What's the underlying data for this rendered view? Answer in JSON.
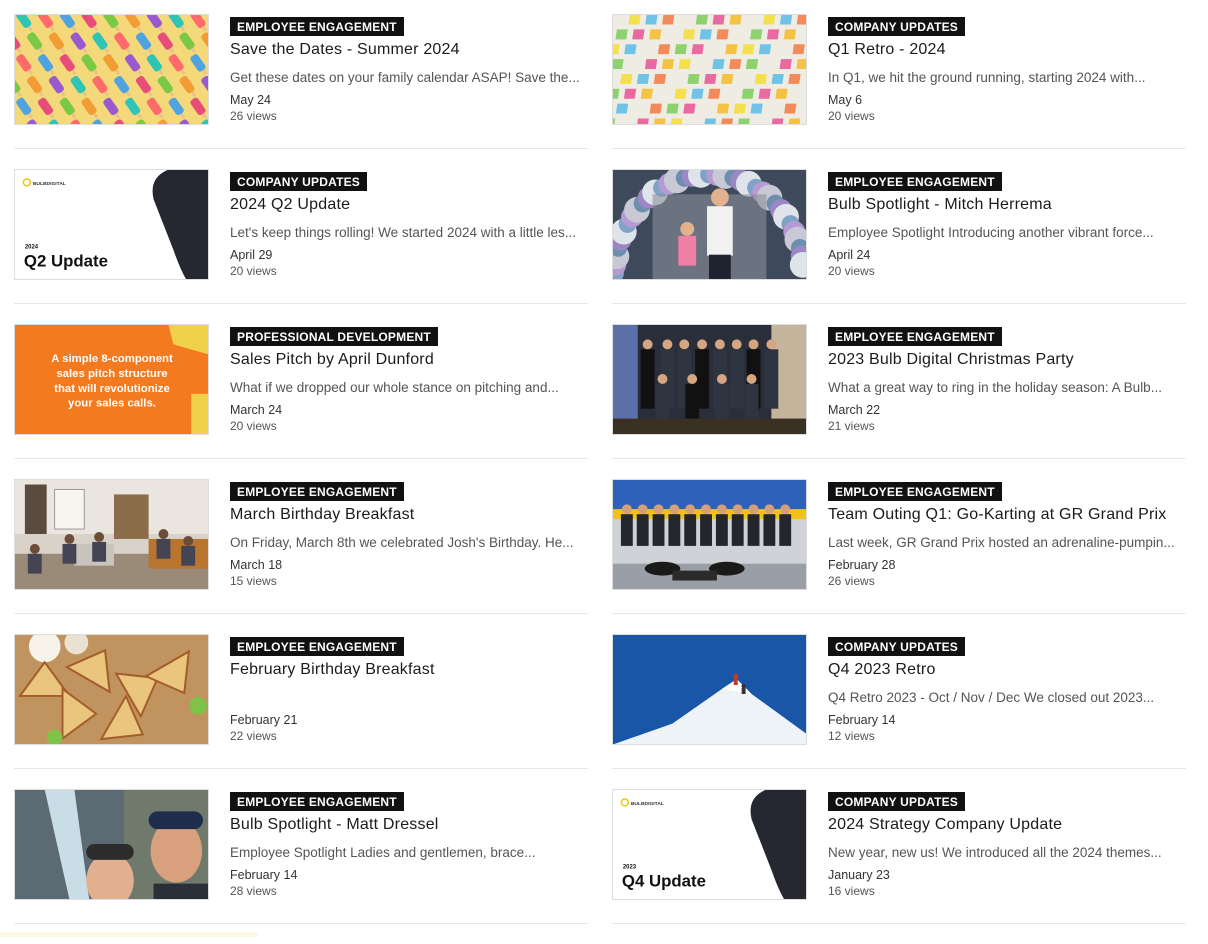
{
  "left": [
    {
      "category": "EMPLOYEE ENGAGEMENT",
      "title": "Save the Dates - Summer 2024",
      "excerpt": "Get these dates on your family calendar ASAP! Save the...",
      "date": "May 24",
      "views": "26 views",
      "thumb": "popsicles"
    },
    {
      "category": "COMPANY UPDATES",
      "title": "2024 Q2 Update",
      "excerpt": "Let's keep things rolling! We started 2024 with a little les...",
      "date": "April 29",
      "views": "20 views",
      "thumb": "slide-q2",
      "slide_year": "2024",
      "slide_title": "Q2 Update",
      "slide_logo": "BULBDIGITAL"
    },
    {
      "category": "PROFESSIONAL DEVELOPMENT",
      "title": "Sales Pitch by April Dunford",
      "excerpt": "What if we dropped our whole stance on pitching and...",
      "date": "March 24",
      "views": "20 views",
      "thumb": "orange-pitch",
      "thumb_text": "A simple 8-component sales pitch structure that will revolutionize your sales calls."
    },
    {
      "category": "EMPLOYEE ENGAGEMENT",
      "title": "March Birthday Breakfast",
      "excerpt": "On Friday, March 8th we celebrated Josh's Birthday. He...",
      "date": "March 18",
      "views": "15 views",
      "thumb": "office"
    },
    {
      "category": "EMPLOYEE ENGAGEMENT",
      "title": "February Birthday Breakfast",
      "excerpt": "",
      "date": "February 21",
      "views": "22 views",
      "thumb": "food"
    },
    {
      "category": "EMPLOYEE ENGAGEMENT",
      "title": "Bulb Spotlight - Matt Dressel",
      "excerpt": "Employee Spotlight Ladies and gentlemen, brace...",
      "date": "February 14",
      "views": "28 views",
      "thumb": "selfie"
    }
  ],
  "right": [
    {
      "category": "COMPANY UPDATES",
      "title": "Q1 Retro - 2024",
      "excerpt": "In Q1, we hit the ground running, starting 2024 with...",
      "date": "May 6",
      "views": "20 views",
      "thumb": "sticky-notes"
    },
    {
      "category": "EMPLOYEE ENGAGEMENT",
      "title": "Bulb Spotlight - Mitch Herrema",
      "excerpt": "Employee Spotlight Introducing another vibrant force...",
      "date": "April 24",
      "views": "20 views",
      "thumb": "balloons"
    },
    {
      "category": "EMPLOYEE ENGAGEMENT",
      "title": "2023 Bulb Digital Christmas Party",
      "excerpt": "What a great way to ring in the holiday season: A Bulb...",
      "date": "March 22",
      "views": "21 views",
      "thumb": "party"
    },
    {
      "category": "EMPLOYEE ENGAGEMENT",
      "title": "Team Outing Q1: Go-Karting at GR Grand Prix",
      "excerpt": "Last week, GR Grand Prix hosted an adrenaline-pumpin...",
      "date": "February 28",
      "views": "26 views",
      "thumb": "karting"
    },
    {
      "category": "COMPANY UPDATES",
      "title": "Q4 2023 Retro",
      "excerpt": "Q4 Retro 2023 - Oct / Nov / Dec We closed out 2023...",
      "date": "February 14",
      "views": "12 views",
      "thumb": "mountain"
    },
    {
      "category": "COMPANY UPDATES",
      "title": "2024 Strategy Company Update",
      "excerpt": "New year, new us! We introduced all the 2024 themes...",
      "date": "January 23",
      "views": "16 views",
      "thumb": "slide-q4",
      "slide_year": "2023",
      "slide_title": "Q4 Update",
      "slide_logo": "BULBDIGITAL"
    }
  ]
}
